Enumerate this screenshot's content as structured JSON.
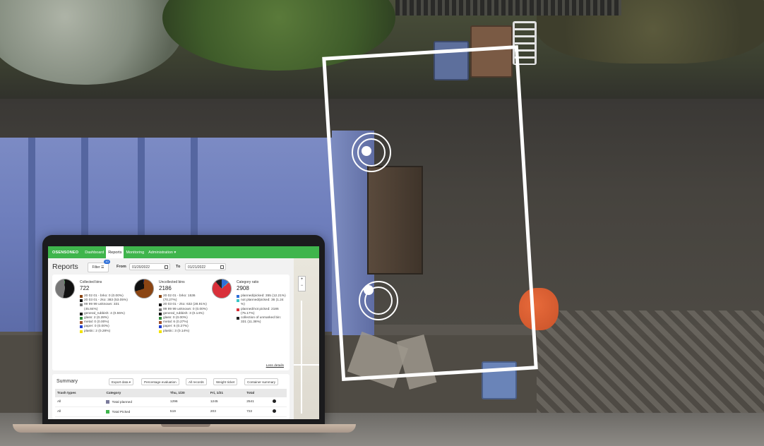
{
  "nav": {
    "brand": "OSENSONEO",
    "items": [
      "Dashboard",
      "Reports",
      "Monitoring",
      "Administration ▾"
    ],
    "active": "Reports"
  },
  "page": {
    "title": "Reports",
    "filter_label": "Filter ☰",
    "filter_count": "10",
    "from_label": "From",
    "from_value": "01/20/2022",
    "to_label": "To",
    "to_value": "01/21/2022"
  },
  "stats": {
    "collected": {
      "title": "Collected bins",
      "value": "722",
      "legend": [
        {
          "text": "20 02 01 - brko: 0 (0.00%)",
          "color": "#8b4513"
        },
        {
          "text": "20 03 01 - zko: 383 (53.05%)",
          "color": "#111111"
        },
        {
          "text": "99 99 99 unknown: 331 (45.84%)",
          "color": "#777777"
        },
        {
          "text": "general_rubbish: 4 (0.55%)",
          "color": "#000000"
        },
        {
          "text": "glass: 2 (0.28%)",
          "color": "#2e8b3a"
        },
        {
          "text": "metal: 0 (0.00%)",
          "color": "#a0522d"
        },
        {
          "text": "paper: 0 (0.00%)",
          "color": "#1f3fd0"
        },
        {
          "text": "plastic: 2 (0.28%)",
          "color": "#f2e200"
        }
      ]
    },
    "uncollected": {
      "title": "Uncollected bins",
      "value": "2186",
      "legend": [
        {
          "text": "20 02 01 - brko: 1536 (70.27%)",
          "color": "#8b4513"
        },
        {
          "text": "20 03 01 - zko: 632 (28.91%)",
          "color": "#111111"
        },
        {
          "text": "99 99 99 unknown: 0 (0.00%)",
          "color": "#777777"
        },
        {
          "text": "general_rubbish: 3 (0.14%)",
          "color": "#000000"
        },
        {
          "text": "glass: 0 (0.00%)",
          "color": "#2e8b3a"
        },
        {
          "text": "metal: 6 (0.27%)",
          "color": "#a0522d"
        },
        {
          "text": "paper: 6 (0.27%)",
          "color": "#1f3fd0"
        },
        {
          "text": "plastic: 3 (0.14%)",
          "color": "#f2e200"
        }
      ]
    },
    "ratio": {
      "title": "Category ratio",
      "value": "2908",
      "legend": [
        {
          "text": "planned/picked: 355 (12.21%)",
          "color": "#2e6fd8"
        },
        {
          "text": "not planned/picked: 36 (1.24 %)",
          "color": "#3cc6c6"
        },
        {
          "text": "planned/not picked: 2186 (75.17%)",
          "color": "#d9303a"
        },
        {
          "text": "collection of unmarked bin: 331 (11.38%)",
          "color": "#222222"
        }
      ]
    },
    "less_details": "Less details"
  },
  "summary": {
    "title": "Summary",
    "buttons": [
      "Export data ▾",
      "Percentage evaluation",
      "All records",
      "Weight ticket",
      "Container summary"
    ],
    "columns": [
      "Trash types",
      "Category",
      "Thu, 1/20",
      "Fri, 1/21",
      "Total",
      ""
    ],
    "rows": [
      {
        "type": "All",
        "category": "Total planned",
        "color": "#7a7a9a",
        "d1": "1296",
        "d2": "1245",
        "total": "2541"
      },
      {
        "type": "All",
        "category": "Total Picked",
        "color": "#3fb54c",
        "d1": "519",
        "d2": "203",
        "total": "722"
      }
    ]
  },
  "map": {
    "zoom_in": "+",
    "zoom_out": "−"
  }
}
